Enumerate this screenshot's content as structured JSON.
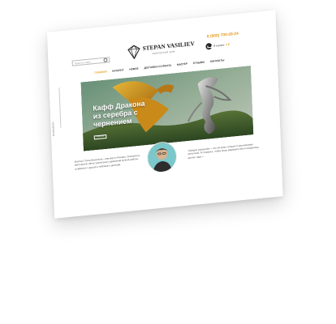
{
  "header": {
    "search_placeholder": "Поиск по сайту",
    "logo": {
      "name": "STEPAN VASILIEV",
      "tagline": "ювелирный дом"
    },
    "phone": "8 (900) 700-28-24",
    "cart": {
      "text": "В корзине",
      "total": "0 ₽"
    }
  },
  "nav": {
    "items": [
      {
        "label": "ГЛАВНАЯ",
        "active": true
      },
      {
        "label": "КАТАЛОГ"
      },
      {
        "label": "НОВОЕ"
      },
      {
        "label": "ДОСТАВКА И ОПЛАТА"
      },
      {
        "label": "МАСТЕР"
      },
      {
        "label": "ОТЗЫВЫ"
      },
      {
        "label": "КОНТАКТЫ"
      }
    ]
  },
  "side": {
    "label": "НОВИНКИ"
  },
  "hero": {
    "title_lines": [
      "Кафф Дракона",
      "из серебра с",
      "чернением"
    ],
    "button": "подробнее"
  },
  "about": {
    "left": "Мастер Степан Васильев – ювелир из Москвы. Основатель мастерской, автор уникальных украшений ручной работы, созданных с душой и любовью к деталям.",
    "right": "«Каждое украшение – это история, которую я рассказываю металлом. Я стараюсь, чтобы вещь радовала своего владельца долгие годы.»"
  },
  "colors": {
    "accent": "#e39b1e",
    "text": "#333333"
  }
}
